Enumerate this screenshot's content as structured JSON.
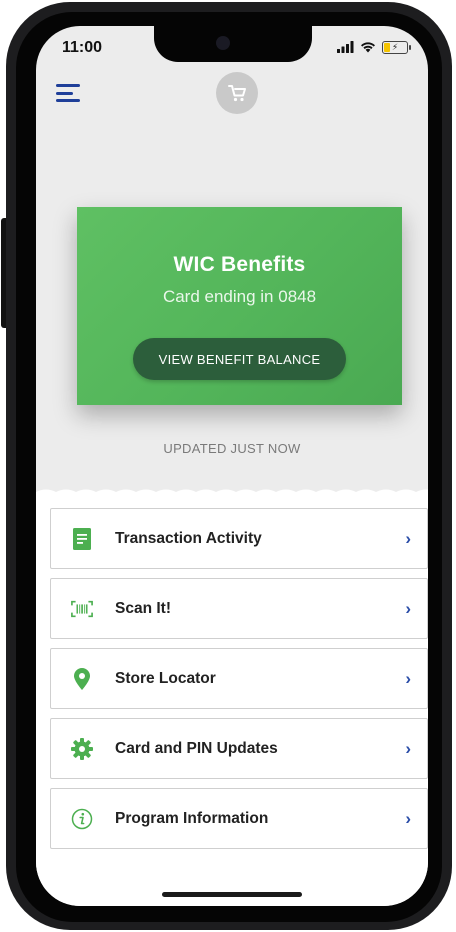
{
  "status_bar": {
    "time": "11:00",
    "icons": [
      "signal-icon",
      "wifi-icon",
      "battery-charging-icon"
    ],
    "battery_level": 0.35
  },
  "header": {
    "menu_icon": "hamburger-menu-icon",
    "cart_icon": "shopping-cart-icon"
  },
  "benefit_card": {
    "title": "WIC Benefits",
    "subtitle": "Card ending in 0848",
    "button_label": "VIEW BENEFIT BALANCE"
  },
  "updated_text": "UPDATED JUST NOW",
  "menu": {
    "items": [
      {
        "label": "Transaction Activity",
        "icon": "document-icon"
      },
      {
        "label": "Scan It!",
        "icon": "barcode-scan-icon"
      },
      {
        "label": "Store Locator",
        "icon": "location-pin-icon"
      },
      {
        "label": "Card and PIN Updates",
        "icon": "gear-icon"
      },
      {
        "label": "Program Information",
        "icon": "info-icon"
      }
    ],
    "chevron": "›"
  },
  "colors": {
    "card_green": "#55b85a",
    "button_dark_green": "#2c5e3b",
    "icon_green": "#4caf50",
    "accent_blue": "#1f3f99"
  }
}
